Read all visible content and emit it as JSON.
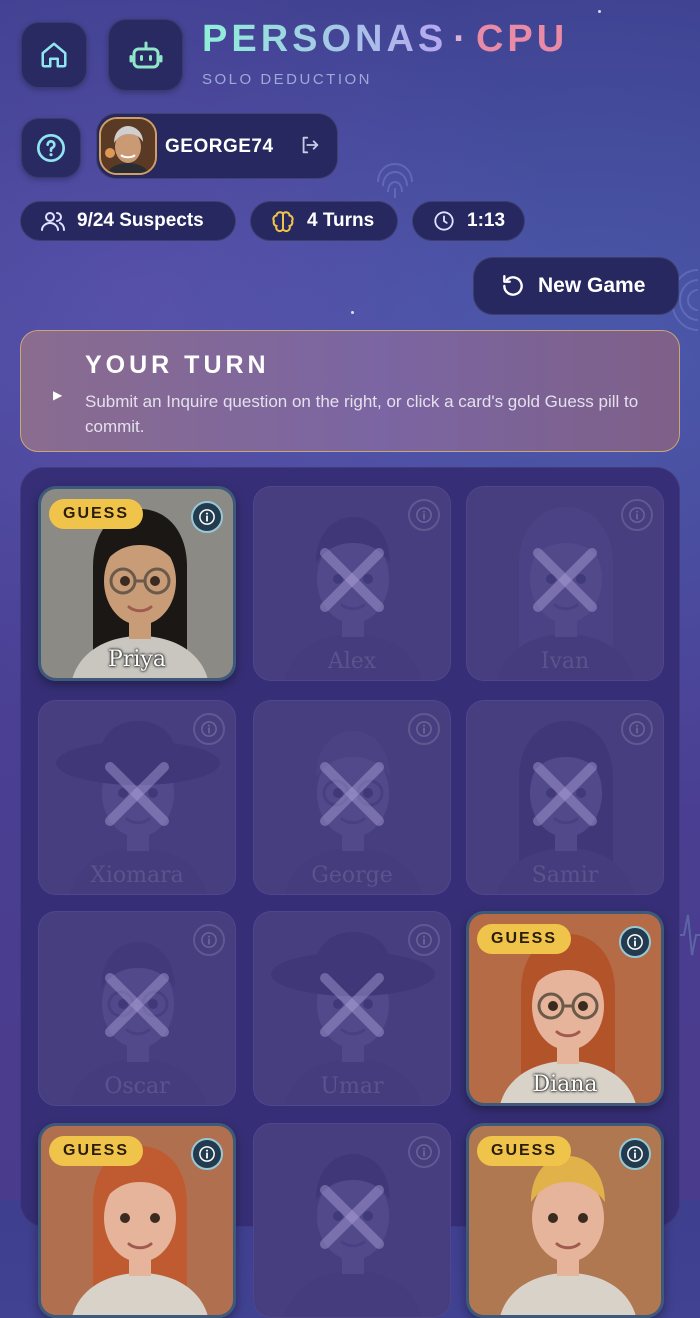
{
  "header": {
    "title_part1": "PERSONAS",
    "title_sep": "·",
    "title_part2": "CPU",
    "subtitle": "SOLO DEDUCTION",
    "home_icon": "home-icon",
    "bot_icon": "robot-icon",
    "help_icon": "help-icon"
  },
  "user": {
    "name": "GEORGE74",
    "logout_icon": "logout-icon"
  },
  "stats": {
    "suspects": "9/24 Suspects",
    "turns": "4 Turns",
    "timer": "1:13"
  },
  "actions": {
    "new_game": "New Game"
  },
  "banner": {
    "heading": "YOUR TURN",
    "message": "Submit an Inquire question on the right, or click a card's gold Guess pill to commit."
  },
  "guess_label": "GUESS",
  "cards": [
    {
      "name": "Priya",
      "eliminated": false
    },
    {
      "name": "Alex",
      "eliminated": true
    },
    {
      "name": "Ivan",
      "eliminated": true
    },
    {
      "name": "Xiomara",
      "eliminated": true
    },
    {
      "name": "George",
      "eliminated": true
    },
    {
      "name": "Samir",
      "eliminated": true
    },
    {
      "name": "Oscar",
      "eliminated": true
    },
    {
      "name": "Umar",
      "eliminated": true
    },
    {
      "name": "Diana",
      "eliminated": false
    },
    {
      "name": "",
      "eliminated": false
    },
    {
      "name": "",
      "eliminated": true
    },
    {
      "name": "",
      "eliminated": false
    }
  ],
  "colors": {
    "accent_gold": "#f0c34a",
    "title_teal": "#8ff0d8",
    "title_pink": "#e98aa7"
  }
}
